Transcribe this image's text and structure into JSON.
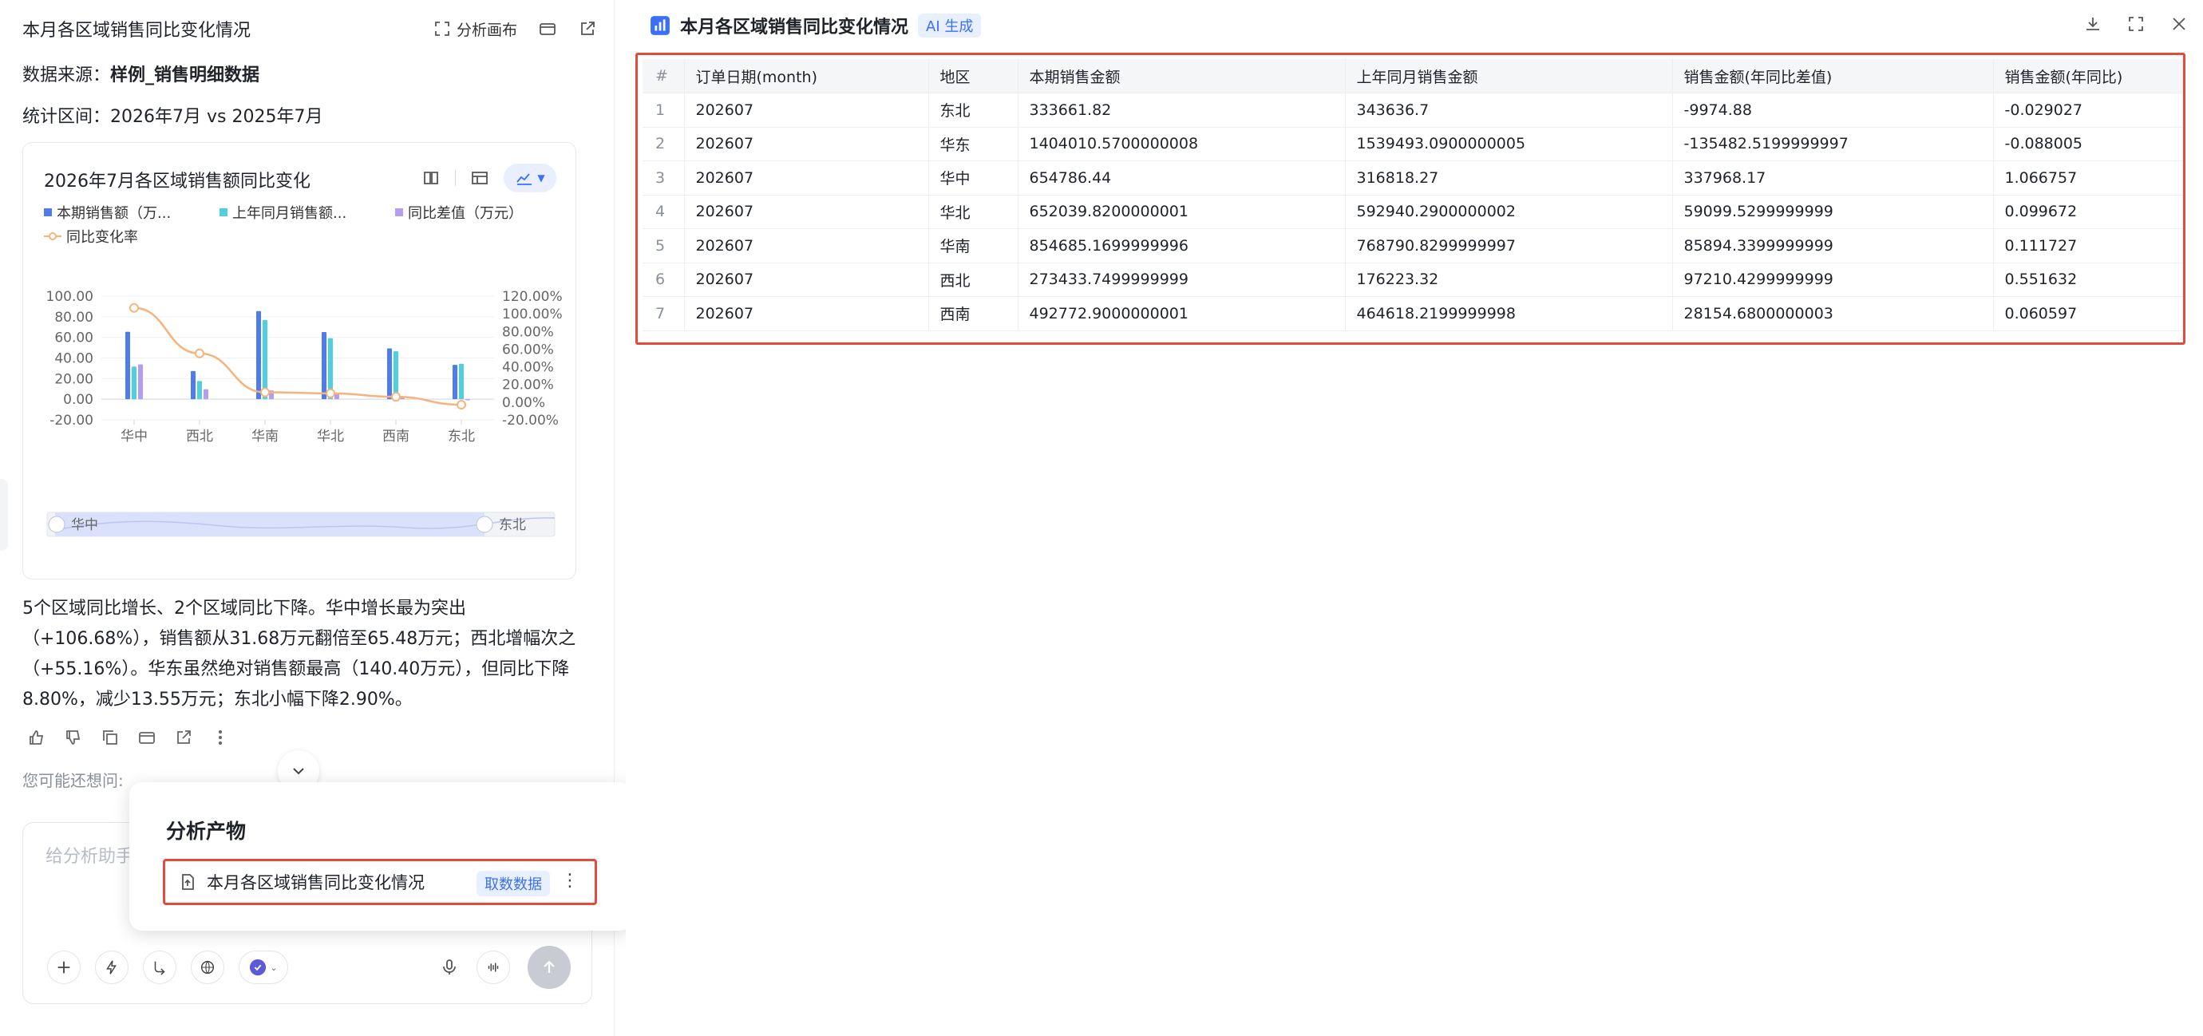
{
  "left": {
    "title": "本月各区域销售同比变化情况",
    "canvas_label": "分析画布",
    "data_source_label": "数据来源：",
    "data_source_value": "样例_销售明细数据",
    "period": "统计区间：2026年7月 vs 2025年7月",
    "summary": "5个区域同比增长、2个区域同比下降。华中增长最为突出（+106.68%），销售额从31.68万元翻倍至65.48万元；西北增幅次之（+55.16%）。华东虽然绝对销售额最高（140.40万元），但同比下降8.80%，减少13.55万元；东北小幅下降2.90%。",
    "maybe_label": "您可能还想问:",
    "input_placeholder": "给分析助手"
  },
  "chart_data": {
    "type": "bar",
    "title": "2026年7月各区域销售额同比变化",
    "categories": [
      "华中",
      "西北",
      "华南",
      "华北",
      "西南",
      "东北"
    ],
    "series": [
      {
        "name": "本期销售额（万...",
        "type": "bar",
        "axis": "left",
        "color": "#4e7cf0",
        "values": [
          65.48,
          27.34,
          85.47,
          65.2,
          49.28,
          33.37
        ]
      },
      {
        "name": "上年同月销售额...",
        "type": "bar",
        "axis": "left",
        "color": "#4fcfe0",
        "values": [
          31.68,
          17.62,
          76.88,
          59.29,
          46.46,
          34.36
        ]
      },
      {
        "name": "同比差值（万元）",
        "type": "bar",
        "axis": "left",
        "color": "#b49cf2",
        "values": [
          33.8,
          9.72,
          8.59,
          5.91,
          2.82,
          -0.99
        ]
      },
      {
        "name": "同比变化率",
        "type": "line",
        "axis": "right",
        "color": "#f6b37a",
        "values": [
          106.68,
          55.16,
          11.17,
          9.97,
          6.06,
          -2.9
        ]
      }
    ],
    "y_left": {
      "min": -20,
      "max": 100,
      "ticks": [
        "100.00",
        "80.00",
        "60.00",
        "40.00",
        "20.00",
        "0.00",
        "-20.00"
      ]
    },
    "y_right": {
      "min": -20,
      "max": 120,
      "ticks": [
        "120.00%",
        "100.00%",
        "80.00%",
        "60.00%",
        "40.00%",
        "20.00%",
        "0.00%",
        "-20.00%"
      ]
    },
    "slider": {
      "start": "华中",
      "end": "东北"
    },
    "legend": "top-left"
  },
  "popover": {
    "title": "分析产物",
    "item_label": "本月各区域销售同比变化情况",
    "item_badge": "取数数据"
  },
  "right": {
    "title": "本月各区域销售同比变化情况",
    "badge": "AI 生成",
    "columns": [
      "#",
      "订单日期(month)",
      "地区",
      "本期销售金额",
      "上年同月销售金额",
      "销售金额(年同比差值)",
      "销售金额(年同比)"
    ],
    "rows": [
      [
        "1",
        "202607",
        "东北",
        "333661.82",
        "343636.7",
        "-9974.88",
        "-0.029027"
      ],
      [
        "2",
        "202607",
        "华东",
        "1404010.5700000008",
        "1539493.0900000005",
        "-135482.5199999997",
        "-0.088005"
      ],
      [
        "3",
        "202607",
        "华中",
        "654786.44",
        "316818.27",
        "337968.17",
        "1.066757"
      ],
      [
        "4",
        "202607",
        "华北",
        "652039.8200000001",
        "592940.2900000002",
        "59099.5299999999",
        "0.099672"
      ],
      [
        "5",
        "202607",
        "华南",
        "854685.1699999996",
        "768790.8299999997",
        "85894.3399999999",
        "0.111727"
      ],
      [
        "6",
        "202607",
        "西北",
        "273433.7499999999",
        "176223.32",
        "97210.4299999999",
        "0.551632"
      ],
      [
        "7",
        "202607",
        "西南",
        "492772.9000000001",
        "464618.2199999998",
        "28154.6800000003",
        "0.060597"
      ]
    ]
  }
}
